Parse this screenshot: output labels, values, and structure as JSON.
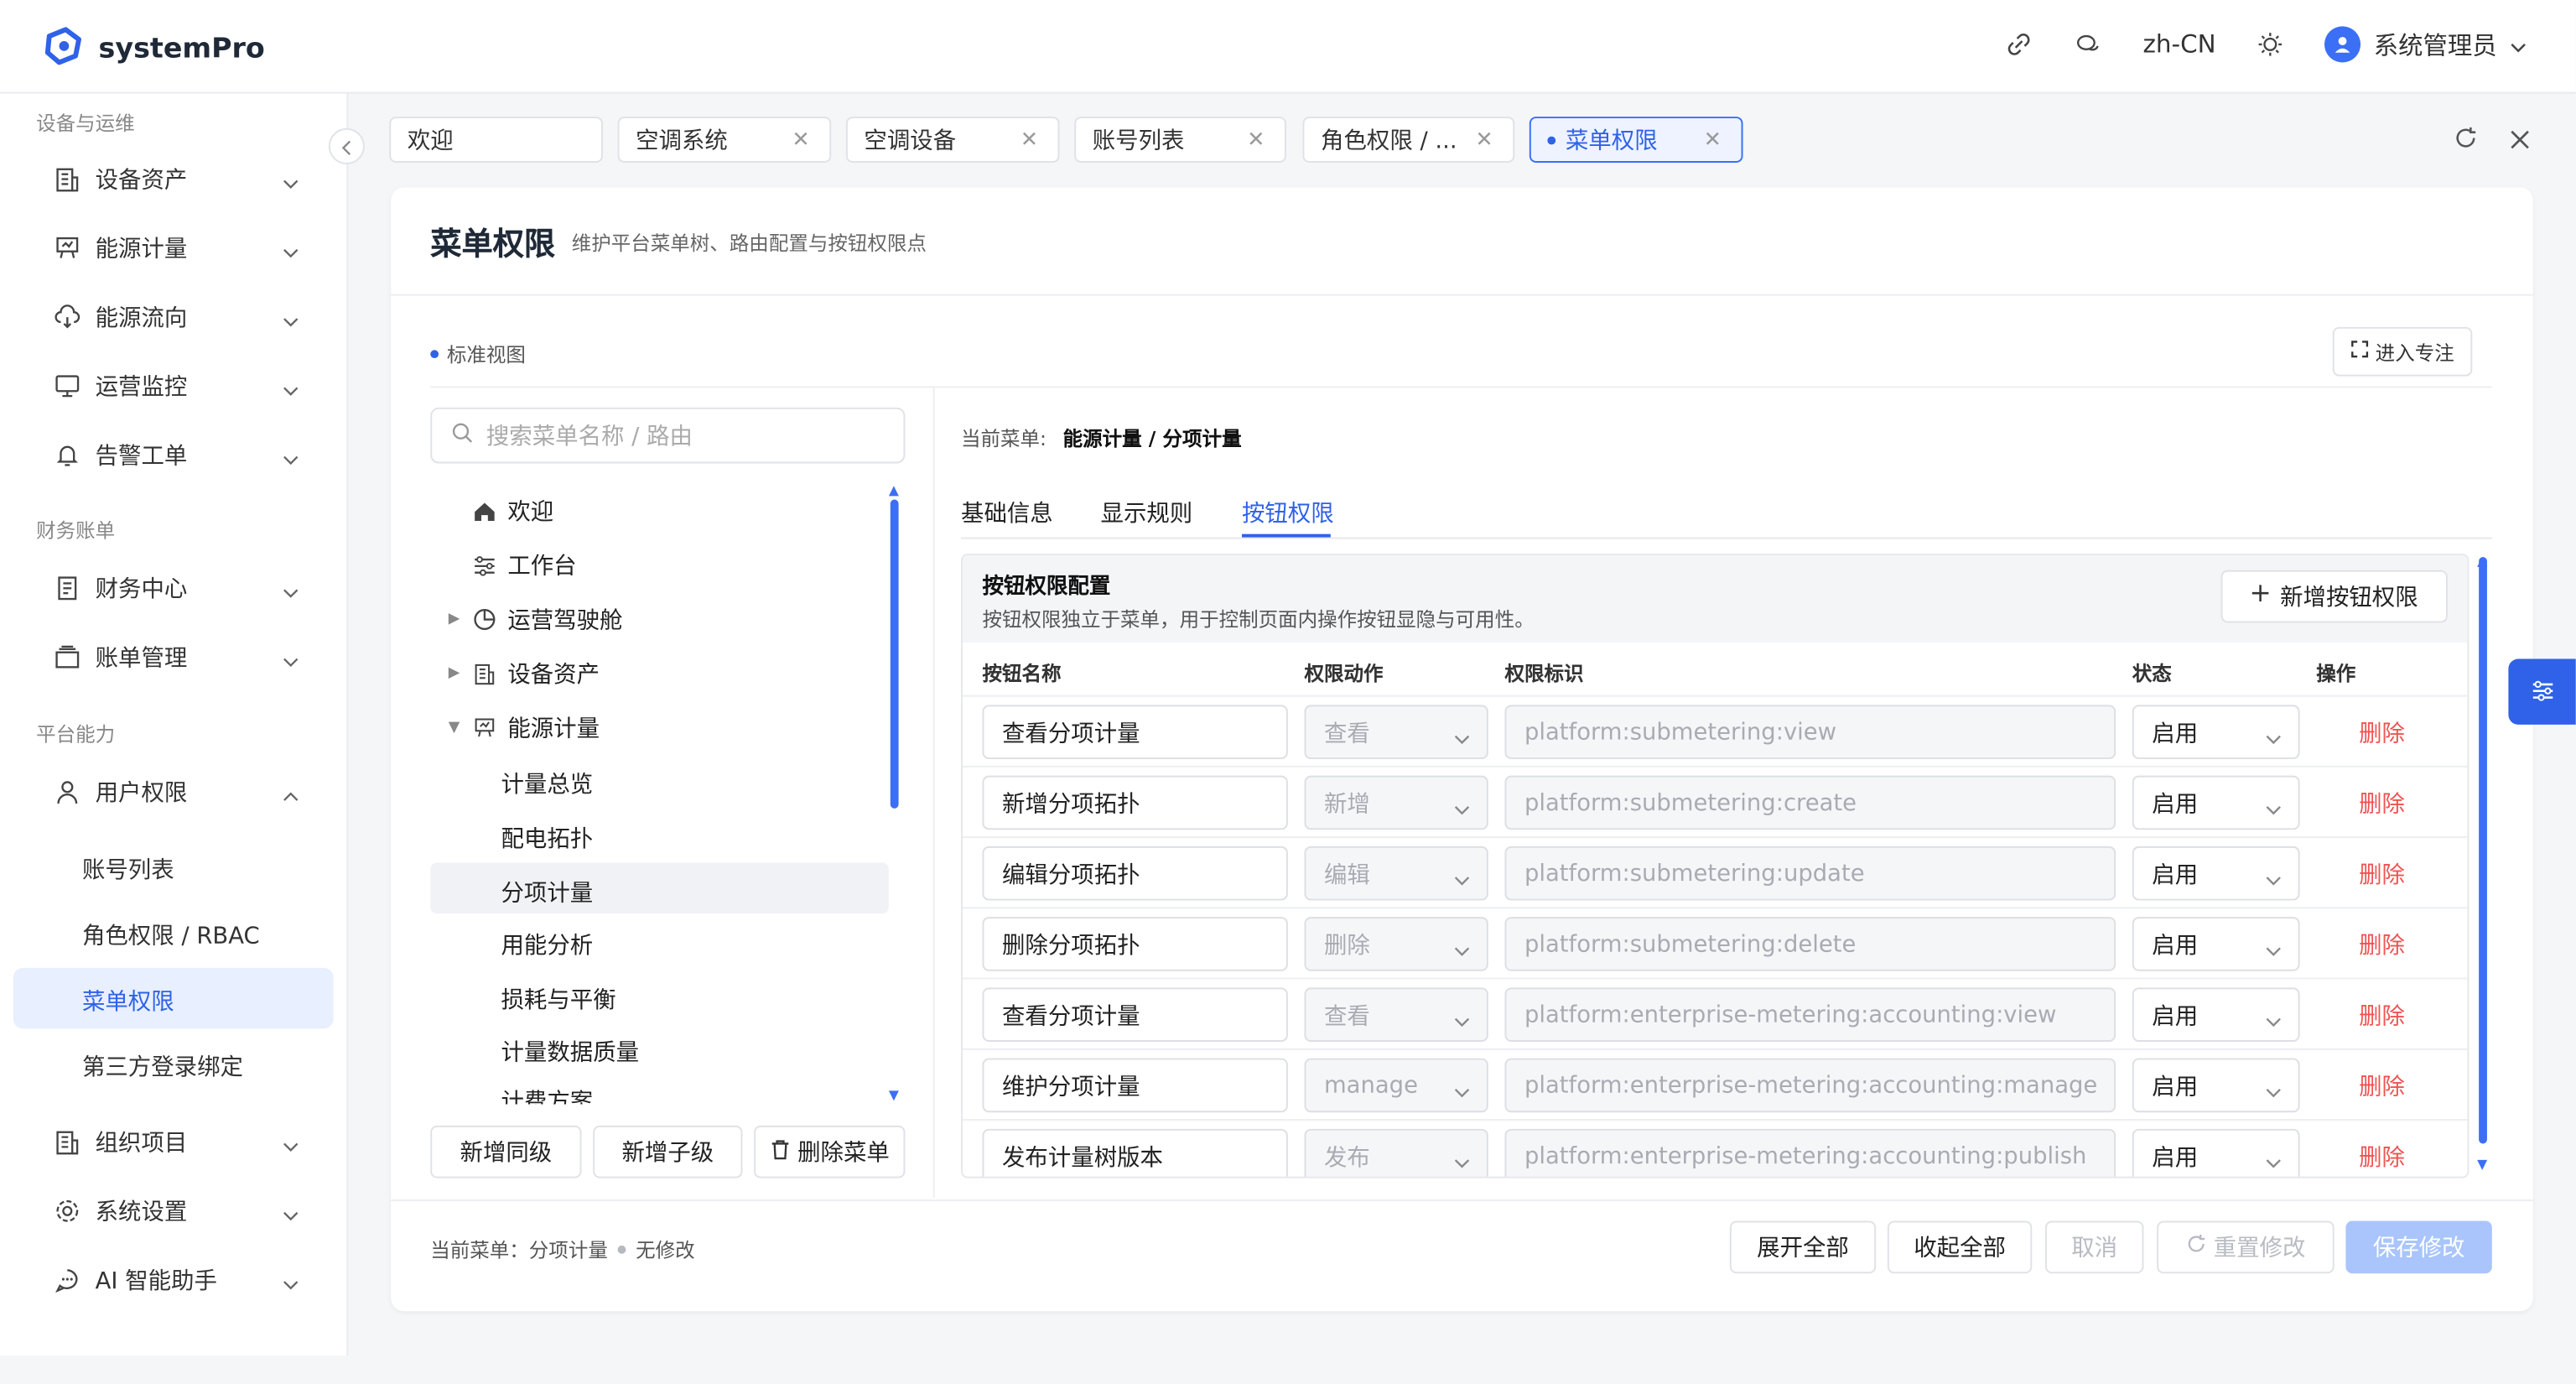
{
  "app": {
    "title": "systemPro",
    "language": "zh-CN",
    "user": "系统管理员",
    "accent": "#2f62e8"
  },
  "sidebar": {
    "groups": [
      "设备与运维",
      "财务账单",
      "平台能力"
    ],
    "items": [
      {
        "label": "设备资产",
        "icon": "building-icon"
      },
      {
        "label": "能源计量",
        "icon": "board-icon"
      },
      {
        "label": "能源流向",
        "icon": "cloud-icon"
      },
      {
        "label": "运营监控",
        "icon": "monitor-icon"
      },
      {
        "label": "告警工单",
        "icon": "bell-icon"
      },
      {
        "label": "财务中心",
        "icon": "document-icon"
      },
      {
        "label": "账单管理",
        "icon": "tray-icon"
      },
      {
        "label": "用户权限",
        "icon": "user-icon"
      },
      {
        "label": "组织项目",
        "icon": "building-icon"
      },
      {
        "label": "系统设置",
        "icon": "gear-icon"
      },
      {
        "label": "AI 智能助手",
        "icon": "chat-icon"
      }
    ],
    "subitems": [
      "账号列表",
      "角色权限 / RBAC",
      "菜单权限",
      "第三方登录绑定"
    ]
  },
  "tabs": [
    "欢迎",
    "空调系统",
    "空调设备",
    "账号列表",
    "角色权限 / ...",
    "菜单权限"
  ],
  "page": {
    "title": "菜单权限",
    "description": "维护平台菜单树、路由配置与按钮权限点",
    "view_tag": "标准视图",
    "focus_button": "进入专注"
  },
  "tree": {
    "search_placeholder": "搜索菜单名称 / 路由",
    "nodes": [
      "欢迎",
      "工作台",
      "运营驾驶舱",
      "设备资产",
      "能源计量",
      "计量总览",
      "配电拓扑",
      "分项计量",
      "用能分析",
      "损耗与平衡",
      "计量数据质量",
      "计费方案"
    ],
    "buttons": [
      "新增同级",
      "新增子级",
      "删除菜单"
    ]
  },
  "detail": {
    "crumb_label": "当前菜单:",
    "crumb_value": "能源计量 / 分项计量",
    "tabs": [
      "基础信息",
      "显示规则",
      "按钮权限"
    ],
    "perm_title": "按钮权限配置",
    "perm_desc": "按钮权限独立于菜单，用于控制页面内操作按钮显隐与可用性。",
    "add_button": "新增按钮权限",
    "columns": [
      "按钮名称",
      "权限动作",
      "权限标识",
      "状态",
      "操作"
    ],
    "rows": [
      {
        "name": "查看分项计量",
        "action": "查看",
        "key": "platform:submetering:view",
        "status": "启用",
        "op": "删除"
      },
      {
        "name": "新增分项拓扑",
        "action": "新增",
        "key": "platform:submetering:create",
        "status": "启用",
        "op": "删除"
      },
      {
        "name": "编辑分项拓扑",
        "action": "编辑",
        "key": "platform:submetering:update",
        "status": "启用",
        "op": "删除"
      },
      {
        "name": "删除分项拓扑",
        "action": "删除",
        "key": "platform:submetering:delete",
        "status": "启用",
        "op": "删除"
      },
      {
        "name": "查看分项计量",
        "action": "查看",
        "key": "platform:enterprise-metering:accounting:view",
        "status": "启用",
        "op": "删除"
      },
      {
        "name": "维护分项计量",
        "action": "manage",
        "key": "platform:enterprise-metering:accounting:manage",
        "status": "启用",
        "op": "删除"
      },
      {
        "name": "发布计量树版本",
        "action": "发布",
        "key": "platform:enterprise-metering:accounting:publish",
        "status": "启用",
        "op": "删除"
      }
    ]
  },
  "footer": {
    "status_label": "当前菜单：分项计量",
    "status_state": "无修改",
    "buttons": [
      "展开全部",
      "收起全部",
      "取消",
      "重置修改",
      "保存修改"
    ]
  }
}
